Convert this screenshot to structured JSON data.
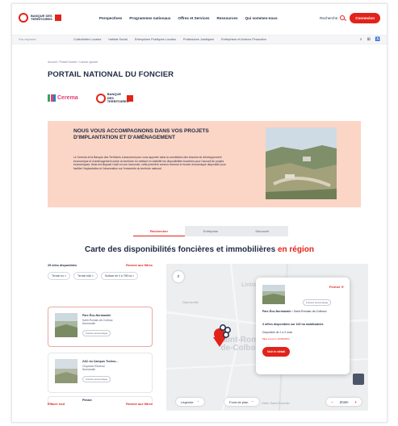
{
  "header": {
    "logo_line1": "BANQUE DES",
    "logo_line2": "TERRITOIRES",
    "nav": [
      "Perspectives",
      "Programmes nationaux",
      "Offres et Services",
      "Ressources",
      "Qui sommes-nous"
    ],
    "search_label": "Recherche",
    "connect_label": "Connexion"
  },
  "subnav": {
    "left_label": "Vos espaces",
    "items": [
      "Collectivités Locales",
      "Habitat Social",
      "Entreprises Publiques Locales",
      "Professions Juridiques",
      "Entreprises et Acteurs Financiers"
    ],
    "icons": [
      "search-icon",
      "grid-icon",
      "accessibility-icon"
    ]
  },
  "breadcrumb": "Accueil / Portail foncier / Lancer ajouter",
  "page_title": "PORTAIL NATIONAL DU FONCIER",
  "partners": {
    "cerema": "Cerema",
    "bdt": "BANQUE DES TERRITOIRES"
  },
  "hero": {
    "title": "NOUS VOUS ACCOMPAGNONS DANS VOS PROJETS D'IMPLANTATION ET D'AMÉNAGEMENT",
    "text": "Le Cerema et la Banque des Territoires s'associent pour vous apporter dans la conciliation des besoins de développement économique et d'aménagement sobre du territoire en mettant en visibilité les disponibilités foncières pour l'accueil de projets économiques. Ainsi est disposé l'outil en une harmonie, cette première version recense le foncier économique disponible pour faciliter l'implantation et l'observation sur l'ensemble du territoire national.",
    "accent_color": "#fbd5c5"
  },
  "tabs": [
    {
      "label": "Rechercher",
      "active": true
    },
    {
      "label": "Entreprise",
      "active": false
    },
    {
      "label": "Découvrir",
      "active": false
    }
  ],
  "map_section": {
    "title": "Carte des disponibilités foncières et immobilières",
    "title_accent": "en région"
  },
  "list": {
    "count_label": "25 sites disponibles",
    "filter_link": "Revenir aux filtres",
    "chips": [
      "Terrain nu",
      "Terrain bâti",
      "Surface de 0 à 758 ha"
    ],
    "cards": [
      {
        "title": "Parc Éco-Normandie",
        "sub": "Saint-Romain-de-Colbosc",
        "sub2": "Normandie",
        "badge": "Foncier économique",
        "selected": true
      },
      {
        "title": "ZAC du Campus Techno...",
        "sub": "Criquetot-l'Esneval",
        "sub2": "Normandie",
        "badge": "Foncier économique",
        "selected": false
      },
      {
        "title": "Pimaxi",
        "sub": "",
        "sub2": "",
        "badge": "",
        "selected": false
      }
    ],
    "footer_left": "Effacer tout",
    "footer_right": "Revenir aux filtres"
  },
  "map": {
    "labels": [
      "Saint-Rom",
      "de-Colbo",
      "Lintot"
    ],
    "small_labels": [
      "Gainneville",
      "Hôtel Saint-Romain"
    ],
    "layer_label": "Légende",
    "source_label": "Fond de plan",
    "zoom_label": "Zoom",
    "zoom_in": "+",
    "zoom_out": "−",
    "popup": {
      "close_label": "Fermer",
      "badge": "Foncier économique",
      "title_bold": "Parc Éco-Normandie",
      "title_rest": " • Saint-Romain-de-Colbosc",
      "offers": "3 offres disponibles sur 163 ha mobilisables",
      "dispo": "Disponible de 2 à 3 mois",
      "date": "Mise à jour le 10/03/2024",
      "button": "Voir le détail"
    }
  },
  "colors": {
    "brand_red": "#e2231a",
    "navy": "#1f2a44"
  }
}
